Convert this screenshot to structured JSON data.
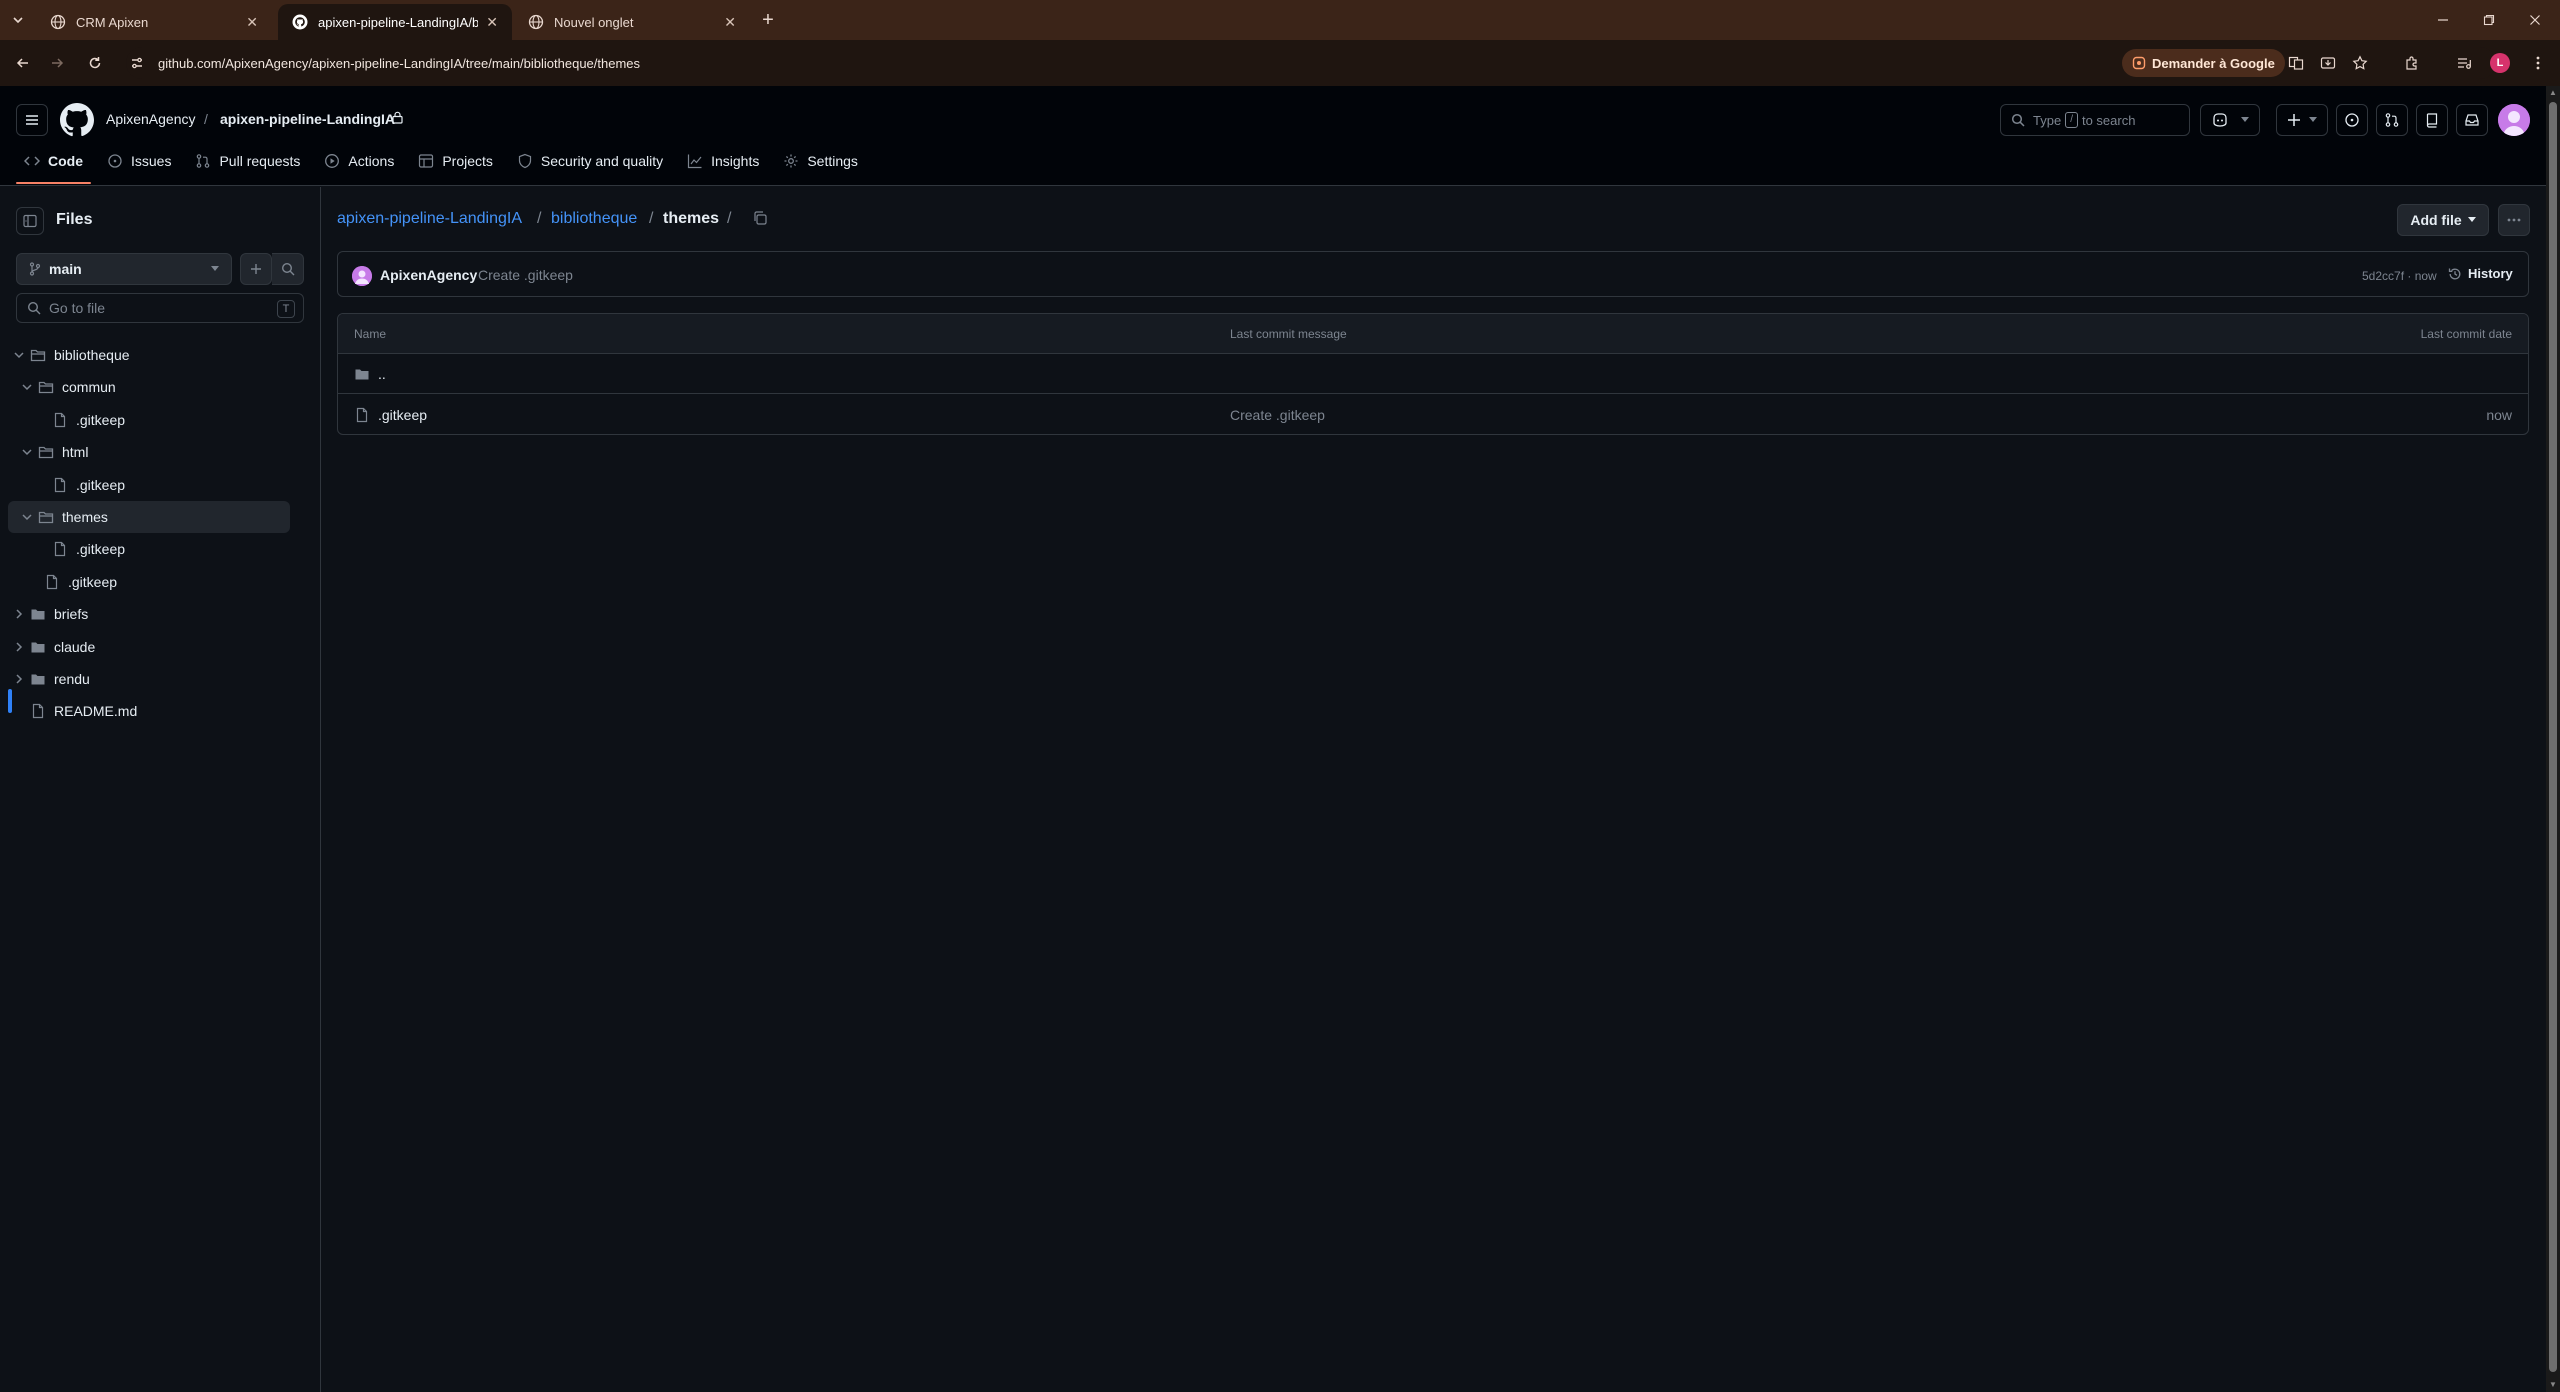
{
  "browser": {
    "tabs": [
      {
        "title": "CRM Apixen",
        "close": "✕"
      },
      {
        "title": "apixen-pipeline-LandingIA/bibl",
        "close": "✕"
      },
      {
        "title": "Nouvel onglet",
        "close": "✕"
      }
    ],
    "new_tab": "+",
    "url": "github.com/ApixenAgency/apixen-pipeline-LandingIA/tree/main/bibliotheque/themes",
    "ask_google": "Demander à Google",
    "profile_initial": "L"
  },
  "header": {
    "owner": "ApixenAgency",
    "separator": "/",
    "repo": "apixen-pipeline-LandingIA",
    "search_prefix": "Type",
    "search_key": "/",
    "search_suffix": "to search"
  },
  "repo_nav": [
    {
      "label": "Code",
      "icon": "code-icon"
    },
    {
      "label": "Issues",
      "icon": "issue-icon"
    },
    {
      "label": "Pull requests",
      "icon": "pull-request-icon"
    },
    {
      "label": "Actions",
      "icon": "play-icon"
    },
    {
      "label": "Projects",
      "icon": "table-icon"
    },
    {
      "label": "Security and quality",
      "icon": "shield-icon"
    },
    {
      "label": "Insights",
      "icon": "graph-icon"
    },
    {
      "label": "Settings",
      "icon": "gear-icon"
    }
  ],
  "sidebar": {
    "title": "Files",
    "branch": "main",
    "goto_placeholder": "Go to file",
    "goto_key": "T",
    "tree": [
      {
        "label": "bibliotheque",
        "type": "folder",
        "expanded": true,
        "depth": 0
      },
      {
        "label": "commun",
        "type": "folder",
        "expanded": true,
        "depth": 1
      },
      {
        "label": ".gitkeep",
        "type": "file",
        "depth": 2
      },
      {
        "label": "html",
        "type": "folder",
        "expanded": true,
        "depth": 1
      },
      {
        "label": ".gitkeep",
        "type": "file",
        "depth": 2
      },
      {
        "label": "themes",
        "type": "folder",
        "expanded": true,
        "depth": 1,
        "selected": true
      },
      {
        "label": ".gitkeep",
        "type": "file",
        "depth": 2
      },
      {
        "label": ".gitkeep",
        "type": "file",
        "depth": 1
      },
      {
        "label": "briefs",
        "type": "folder",
        "expanded": false,
        "depth": 0
      },
      {
        "label": "claude",
        "type": "folder",
        "expanded": false,
        "depth": 0
      },
      {
        "label": "rendu",
        "type": "folder",
        "expanded": false,
        "depth": 0
      },
      {
        "label": "README.md",
        "type": "file",
        "depth": 0
      }
    ]
  },
  "main": {
    "breadcrumb": {
      "repo": "apixen-pipeline-LandingIA",
      "sep": "/",
      "folder": "bibliotheque",
      "current": "themes"
    },
    "add_file": "Add file",
    "commit": {
      "author": "ApixenAgency",
      "message": "Create .gitkeep",
      "meta": "5d2cc7f · now",
      "history": "History"
    },
    "table": {
      "headers": {
        "name": "Name",
        "message": "Last commit message",
        "date": "Last commit date"
      },
      "rows": [
        {
          "name": "..",
          "type": "folder",
          "message": "",
          "date": ""
        },
        {
          "name": ".gitkeep",
          "type": "file",
          "message": "Create .gitkeep",
          "date": "now"
        }
      ]
    }
  },
  "colors": {
    "accent_link": "#4493f8",
    "tab_underline": "#f78166",
    "chrome_bg": "#3b2418"
  }
}
